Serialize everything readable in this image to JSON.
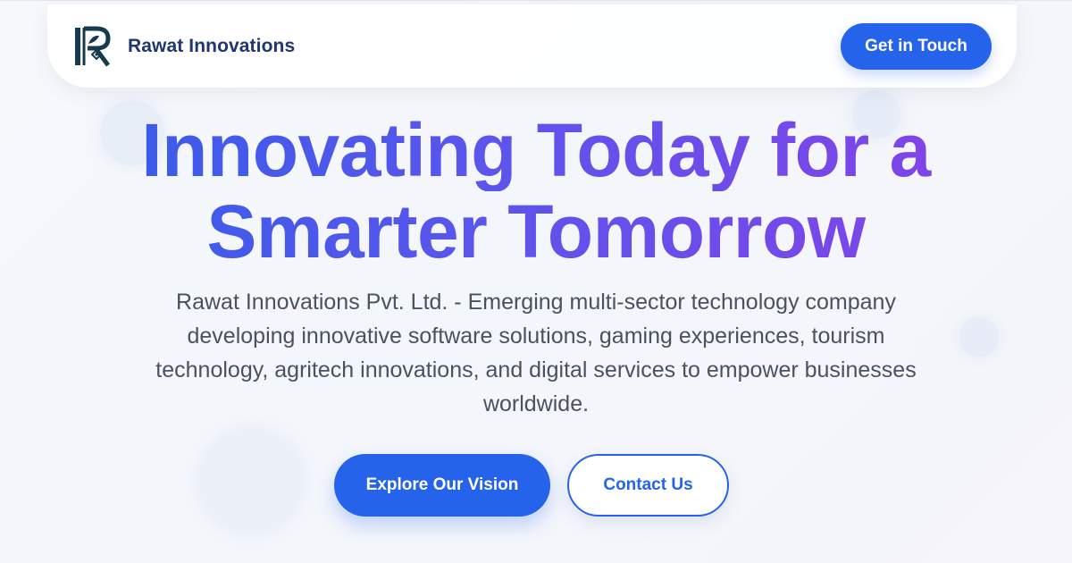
{
  "header": {
    "brand_name": "Rawat Innovations",
    "logo_icon": "rawat-innovations-logo",
    "cta_label": "Get in Touch"
  },
  "hero": {
    "title_line1": "Innovating Today for a",
    "title_line2": "Smarter Tomorrow",
    "description": "Rawat Innovations Pvt. Ltd. - Emerging multi-sector technology company developing innovative software solutions, gaming experiences, tourism technology, agritech innovations, and digital services to empower businesses worldwide.",
    "primary_button": "Explore Our Vision",
    "secondary_button": "Contact Us"
  },
  "colors": {
    "accent": "#2563eb",
    "brand_text": "#1f3670",
    "gradient_start": "#2f5ee8",
    "gradient_end": "#8b3fe6",
    "body_text": "#4a5260"
  }
}
